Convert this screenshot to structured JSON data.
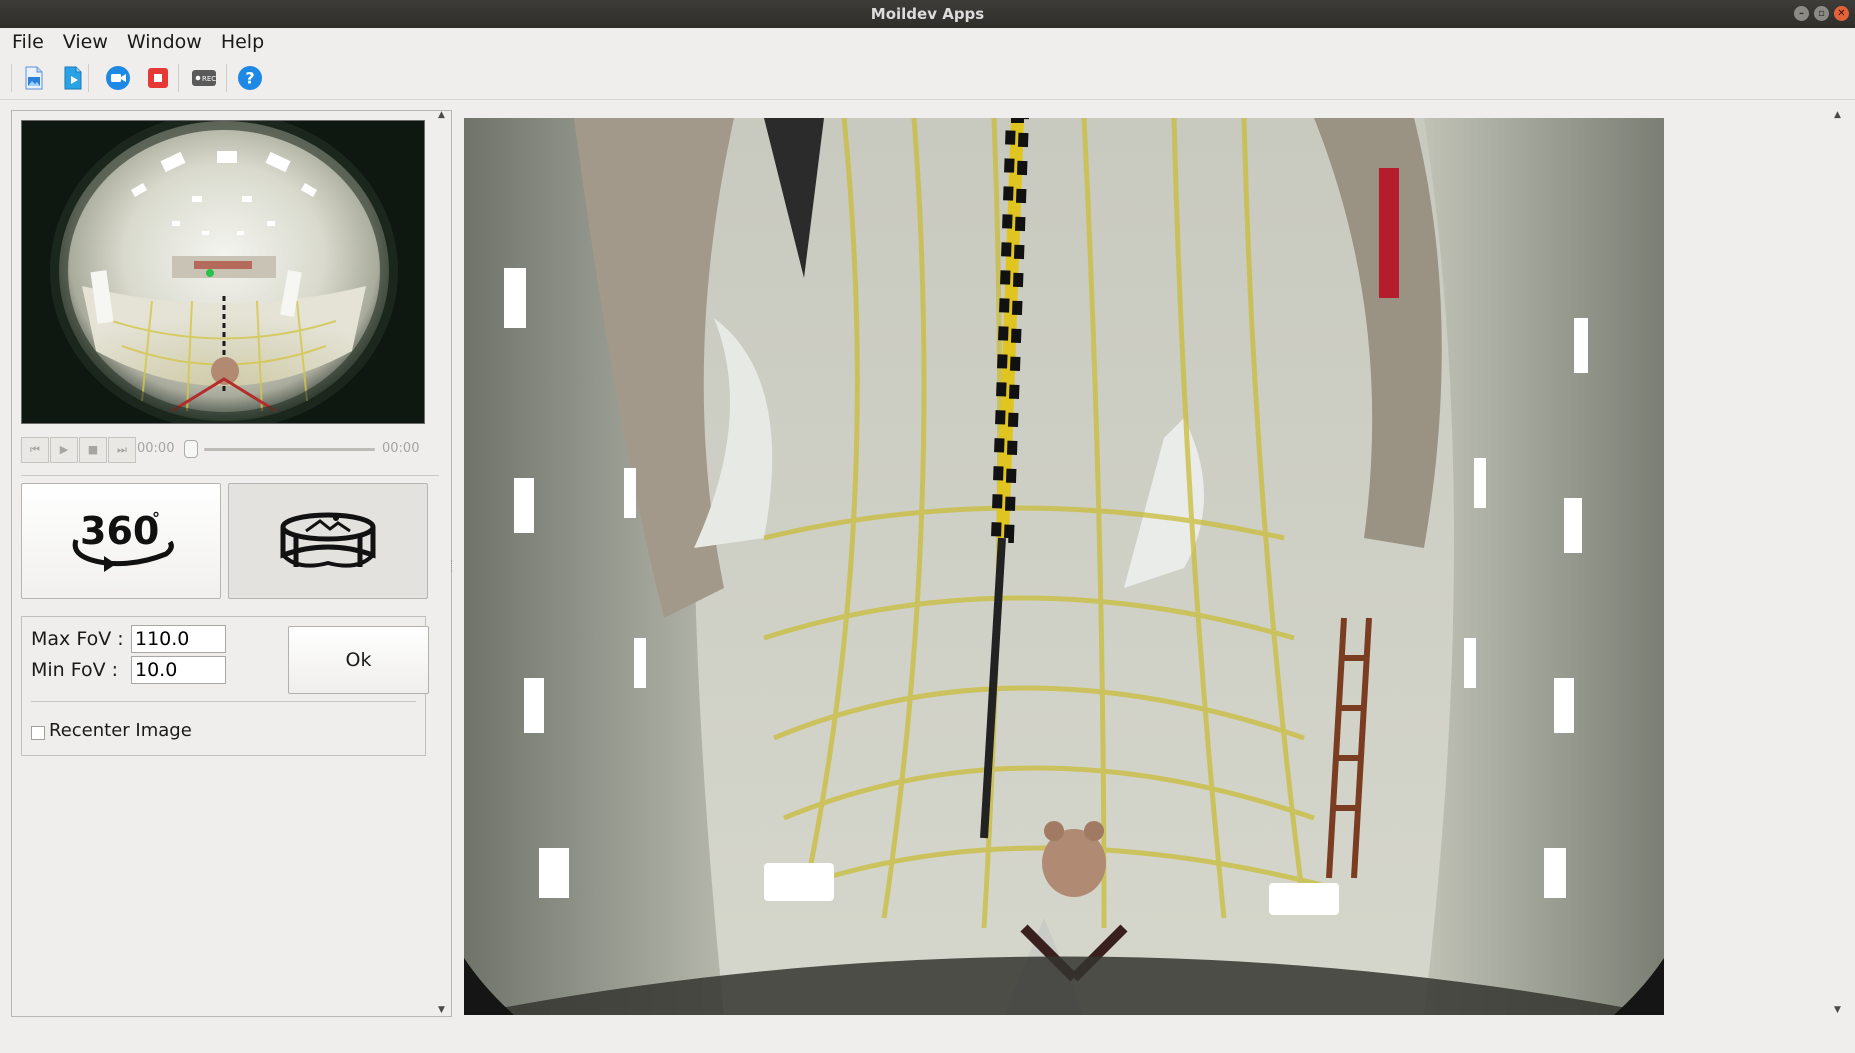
{
  "window": {
    "title": "Moildev Apps",
    "buttons": [
      "minimize",
      "maximize",
      "close"
    ]
  },
  "menubar": {
    "items": [
      "File",
      "View",
      "Window",
      "Help"
    ]
  },
  "toolbar": {
    "buttons": [
      {
        "name": "open-image",
        "icon": "image-file-icon",
        "tooltip": ""
      },
      {
        "name": "open-video",
        "icon": "video-file-icon",
        "tooltip": ""
      },
      {
        "name": "open-camera",
        "icon": "camera-icon",
        "tooltip": ""
      },
      {
        "name": "stop",
        "icon": "stop-icon",
        "tooltip": ""
      },
      {
        "name": "record",
        "icon": "record-icon",
        "tooltip": ""
      },
      {
        "name": "help",
        "icon": "help-icon",
        "tooltip": ""
      }
    ]
  },
  "player": {
    "time_current": "00:00",
    "time_total": "00:00"
  },
  "modes": {
    "panorama_label": "360",
    "panorama_degree": "°"
  },
  "fov": {
    "max_label": "Max FoV :",
    "max_value": "110.0",
    "min_label": "Min FoV  :",
    "min_value": "10.0",
    "ok_label": "Ok",
    "recenter_label": "Recenter Image",
    "recenter_checked": false
  },
  "colors": {
    "accent_blue": "#1e88e5",
    "stop_red": "#e53935",
    "titlebar": "#3a3935",
    "close_button": "#e2623a"
  }
}
